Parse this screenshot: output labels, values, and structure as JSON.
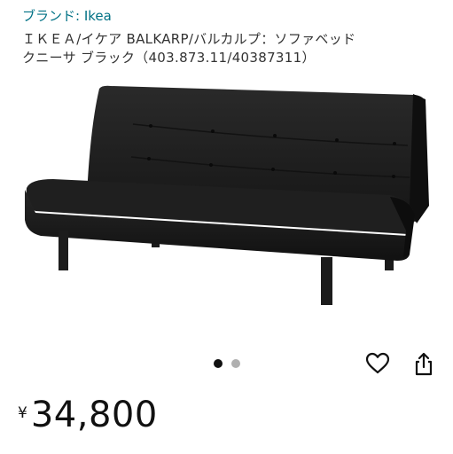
{
  "header": {
    "brand_prefix": "ブランド: ",
    "brand_name": "Ikea"
  },
  "product": {
    "title_line1": "ＩＫＥＡ/イケア BALKARP/バルカルプ：ソファベッド",
    "title_line2": "クニーサ ブラック（403.873.11/40387311）",
    "image_icon": "sofa-bed-image",
    "image_color": "#1c1c1c"
  },
  "carousel": {
    "total": 2,
    "active_index": 0
  },
  "actions": {
    "favorite_icon": "heart-icon",
    "share_icon": "share-icon"
  },
  "price": {
    "currency": "¥",
    "amount": "34,800"
  },
  "colors": {
    "link": "#007185",
    "text": "#333333",
    "price": "#111111"
  }
}
